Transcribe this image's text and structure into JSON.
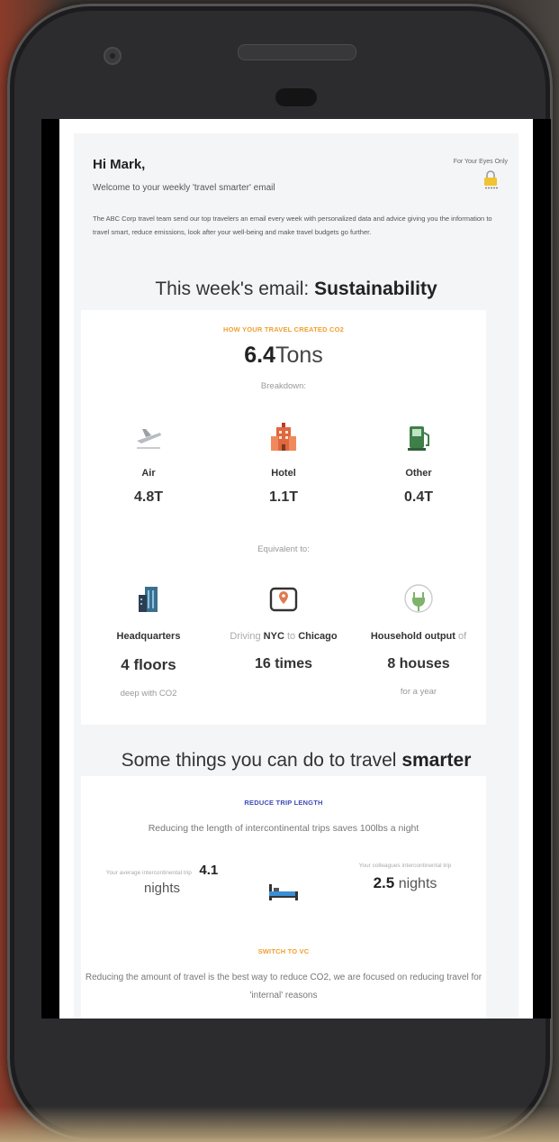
{
  "email": {
    "greeting": "Hi Mark,",
    "welcome": "Welcome to your weekly 'travel smarter' email",
    "badge": "For Your Eyes Only",
    "intro": "The ABC Corp travel team send our top travelers an email every week with personalized data and advice giving you the information to travel smart, reduce emissions, look after your well-being and make travel budgets go further."
  },
  "week": {
    "prefix": "This week's email: ",
    "topic": "Sustainability"
  },
  "co2": {
    "kicker": "HOW YOUR TRAVEL CREATED CO2",
    "total_value": "6.4",
    "total_unit": "Tons",
    "breakdown_label": "Breakdown:",
    "breakdown": [
      {
        "label": "Air",
        "value": "4.8T",
        "icon": "airplane-icon"
      },
      {
        "label": "Hotel",
        "value": "1.1T",
        "icon": "hotel-icon"
      },
      {
        "label": "Other",
        "value": "0.4T",
        "icon": "fuel-pump-icon"
      }
    ],
    "equivalent_label": "Equivalent to:",
    "equivalents": {
      "hq": {
        "label": "Headquarters",
        "value": "4 floors",
        "sub": "deep with CO2"
      },
      "driving": {
        "pre": "Driving ",
        "from": "NYC",
        "mid": " to ",
        "to": "Chicago",
        "value": "16 times"
      },
      "household": {
        "label": "Household output",
        "suffix": " of",
        "value": "8 houses",
        "sub": "for a year"
      }
    },
    "colors": {
      "kicker": "#f0a030",
      "hq_icon": "#3a6f8f",
      "map_icon": "#e07a52",
      "plug_icon": "#7db36b"
    }
  },
  "tips": {
    "prefix": "Some things you can do to travel ",
    "emphasis": "smarter",
    "reduce": {
      "kicker": "REDUCE TRIP LENGTH",
      "desc": "Reducing the length of intercontinental trips saves 100lbs a night",
      "your_label": "Your average intercontinental trip",
      "your_value": "4.1",
      "your_unit": "nights",
      "colleagues_label": "Your colleagues intercontinental trip",
      "colleagues_value": "2.5",
      "colleagues_unit": "nights",
      "kicker_color": "#3d4db8"
    },
    "vc": {
      "kicker": "SWITCH TO VC",
      "desc": "Reducing the amount of travel is the best way to reduce CO2, we are focused on reducing travel for 'internal' reasons",
      "kicker_color": "#f0a030"
    }
  }
}
